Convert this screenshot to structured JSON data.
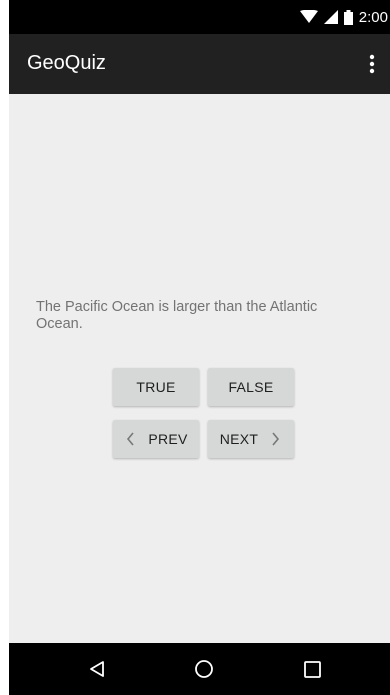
{
  "status_bar": {
    "time": "2:00",
    "icons": [
      "wifi-icon",
      "signal-icon",
      "battery-icon"
    ]
  },
  "app_bar": {
    "title": "GeoQuiz",
    "menu_icon": "more-vert-icon"
  },
  "question": {
    "text": "The Pacific Ocean is larger than the Atlantic Ocean."
  },
  "buttons": {
    "true_label": "TRUE",
    "false_label": "FALSE",
    "prev_label": "PREV",
    "next_label": "NEXT"
  },
  "nav_bar": {
    "icons": [
      "back-icon",
      "home-icon",
      "recents-icon"
    ]
  },
  "colors": {
    "app_bar": "#212121",
    "content_bg": "#eeeeee",
    "button_bg": "#d6d7d7",
    "question_text": "#737373"
  }
}
